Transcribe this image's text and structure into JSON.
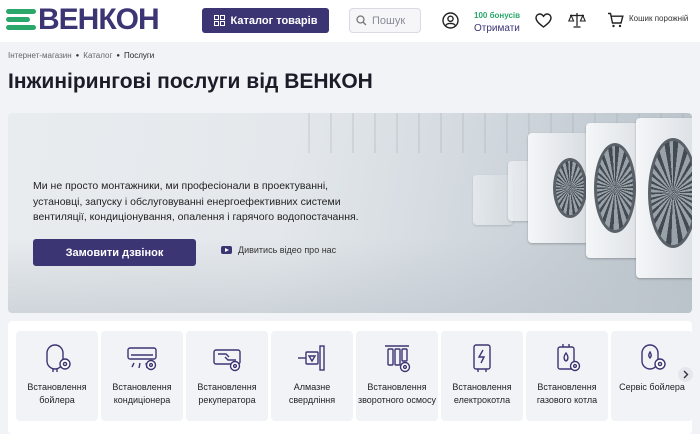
{
  "header": {
    "logo_text": "ВЕНКОН",
    "catalog_label": "Каталог товарів",
    "search_placeholder": "Пошук",
    "bonus_count": "100 бонусів",
    "bonus_action": "Отримати",
    "cart_label": "Кошик порожній"
  },
  "breadcrumb": [
    "Інтернет-магазин",
    "Каталог",
    "Послуги"
  ],
  "page_title": "Інжинірингові послуги від ВЕНКОН",
  "hero": {
    "description": "Ми не просто монтажники, ми професіонали в проектуванні, установці, запуску і обслуговуванні енергоефективних системи вентиляції, кондиціонування, опалення і гарячого водопостачання.",
    "order_button": "Замовити дзвінок",
    "video_link": "Дивитись відео про нас"
  },
  "services": [
    {
      "label": "Встановлення бойлера",
      "icon": "boiler-icon"
    },
    {
      "label": "Встановлення кондиціонера",
      "icon": "air-conditioner-icon"
    },
    {
      "label": "Встановлення рекуператора",
      "icon": "recuperator-icon"
    },
    {
      "label": "Алмазне свердління",
      "icon": "diamond-drill-icon"
    },
    {
      "label": "Встановлення зворотного осмосу",
      "icon": "reverse-osmosis-icon"
    },
    {
      "label": "Встановлення електрокотла",
      "icon": "electric-boiler-icon"
    },
    {
      "label": "Встановлення газового котла",
      "icon": "gas-boiler-icon"
    },
    {
      "label": "Сервіс бойлера",
      "icon": "boiler-service-icon"
    }
  ],
  "colors": {
    "brand": "#3b3574",
    "accent": "#2aa86b"
  }
}
